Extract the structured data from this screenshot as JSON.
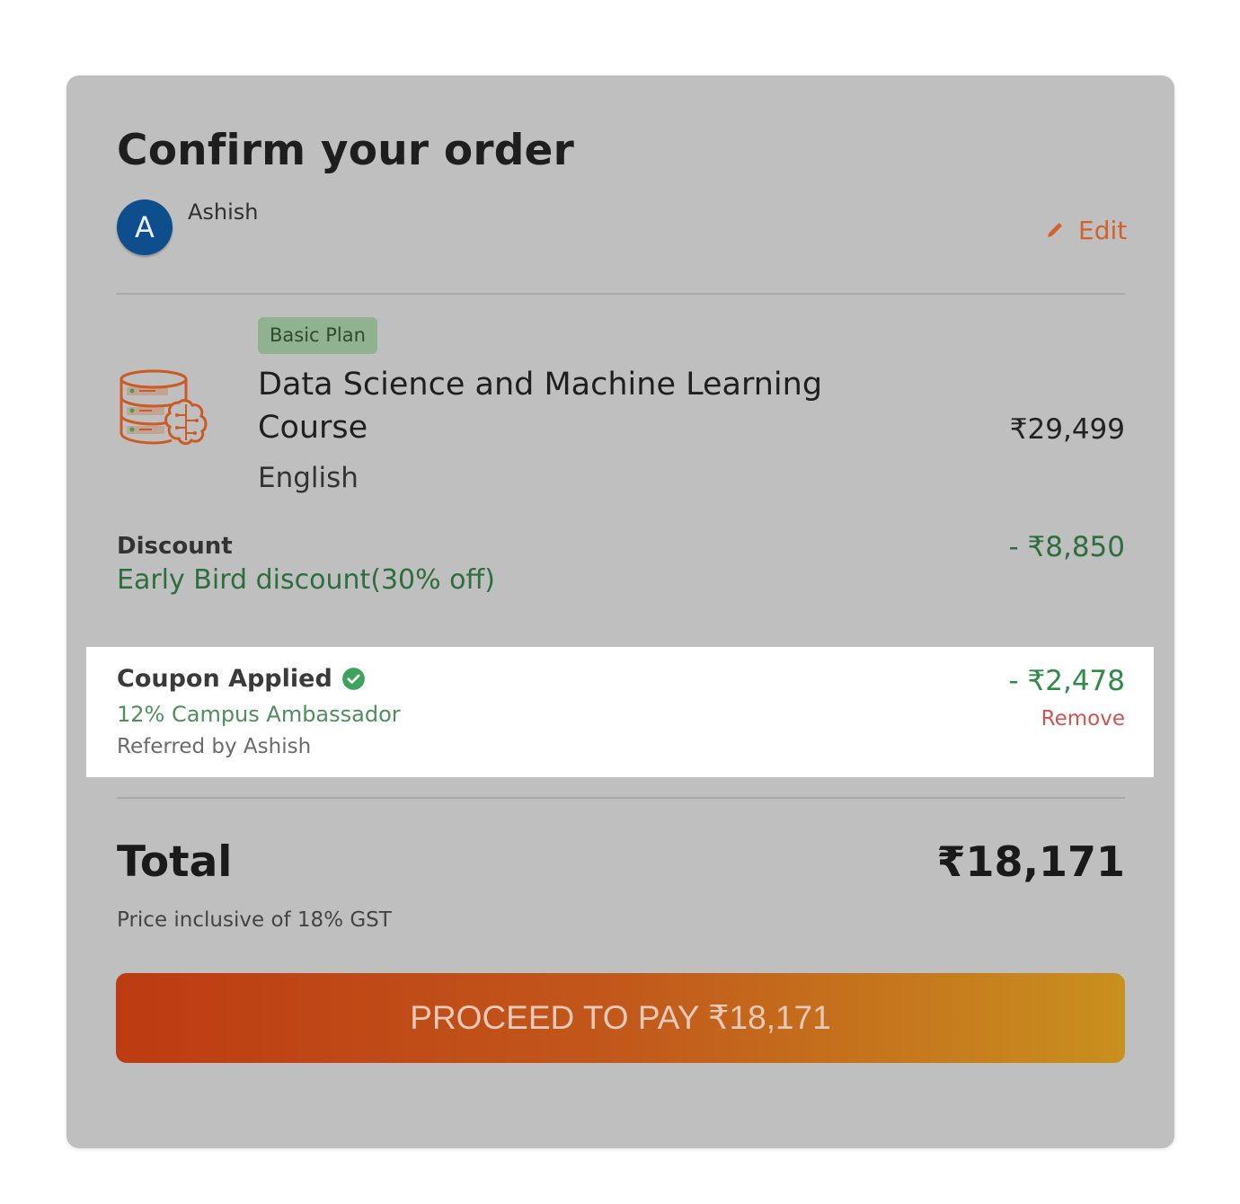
{
  "header": {
    "title": "Confirm your order",
    "user": {
      "initial": "A",
      "name": "Ashish",
      "avatar_color": "#0f4e8c"
    },
    "edit_label": "Edit",
    "edit_icon": "pencil-icon"
  },
  "course": {
    "badge": "Basic Plan",
    "title": "Data Science and Machine Learning Course",
    "language": "English",
    "price": "₹29,499",
    "icon": "database-brain-icon"
  },
  "discount": {
    "label": "Discount",
    "description": "Early Bird discount(30% off)",
    "amount": "- ₹8,850"
  },
  "coupon": {
    "label": "Coupon Applied",
    "status_icon": "check-circle-icon",
    "code_description": "12% Campus Ambassador",
    "referred_by": "Referred by Ashish",
    "amount": "- ₹2,478",
    "remove_label": "Remove"
  },
  "total": {
    "label": "Total",
    "amount": "₹18,171",
    "note": "Price inclusive of 18% GST"
  },
  "pay_button": {
    "label": "PROCEED TO PAY ₹18,171"
  },
  "colors": {
    "accent_orange": "#d2622c",
    "success_green": "#2f8a47",
    "remove_red": "#d25252",
    "pay_gradient_start": "#bd3b12",
    "pay_gradient_end": "#c9901e"
  }
}
